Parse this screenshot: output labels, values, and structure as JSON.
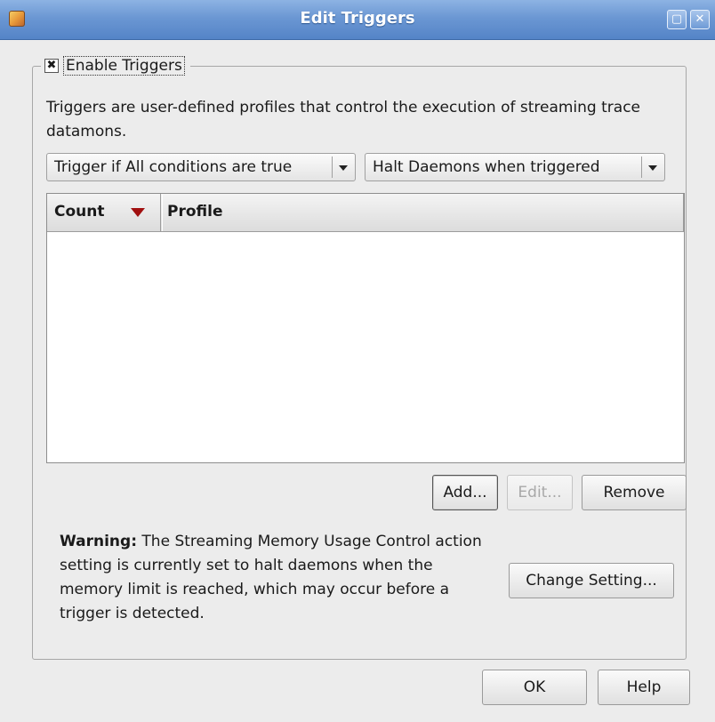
{
  "window": {
    "title": "Edit Triggers"
  },
  "group": {
    "enable_label": "Enable Triggers",
    "enabled": true,
    "description": "Triggers are user-defined profiles that control the execution of streaming trace datamons."
  },
  "combos": {
    "condition": "Trigger if All conditions are true",
    "action": "Halt Daemons when triggered"
  },
  "table": {
    "columns": [
      "Count",
      "Profile"
    ],
    "sort_column": "Count",
    "rows": []
  },
  "buttons": {
    "add": "Add...",
    "edit": "Edit...",
    "remove": "Remove",
    "change_setting": "Change Setting...",
    "ok": "OK",
    "help": "Help"
  },
  "warning": {
    "label": "Warning:",
    "text": " The Streaming Memory Usage Control action setting is currently set to halt daemons when the memory limit is reached, which may occur before a trigger is detected."
  },
  "icons": {
    "app": "app-icon",
    "maximize": "maximize-icon",
    "close": "close-icon",
    "checkbox": "checkbox-checked-icon",
    "sort": "sort-descending-icon",
    "dropdown": "chevron-down-icon"
  },
  "colors": {
    "titlebar": "#6b97d3",
    "sort_arrow": "#a10f0f",
    "background": "#ececec"
  }
}
